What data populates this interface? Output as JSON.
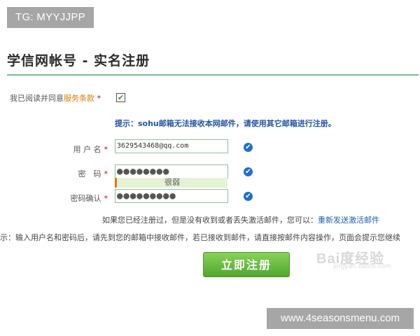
{
  "watermark_tag": "TG: MYYJJPP",
  "title": "学信网帐号 - 实名注册",
  "terms": {
    "prefix": "我已阅读并同意",
    "link_label": "服务条款",
    "required_mark": "*",
    "checked": true,
    "check_glyph": "✔"
  },
  "tip": "提示：sohu邮箱无法接收本网邮件，请使用其它邮箱进行注册。",
  "form": {
    "username": {
      "label": "用 户 名",
      "required_mark": "*",
      "value": "3629543468@qq.com"
    },
    "password": {
      "label": "密　码",
      "required_mark": "*",
      "masked_value": "●●●●●●●●",
      "strength_label": "很弱"
    },
    "confirm": {
      "label": "密码确认",
      "required_mark": "*",
      "masked_value": "●●●●●●●●●"
    }
  },
  "valid_icon_glyph": "✔",
  "resend": {
    "text": "如果您已经注册过，但是没有收到或者丢失激活邮件，您可以：",
    "link_label": "重新发送激活邮件"
  },
  "instruction": "示：输入用户名和密码后，请先到您的邮箱中接收邮件，若已接收到邮件，请直接按邮件内容操作，页面会提示您继续",
  "submit_label": "立即注册",
  "watermark_center": "Bai度经验",
  "watermark_center_sub": "jingyan.baidu.com",
  "site_watermark": "www.4seasonsmenu.com",
  "colors": {
    "accent_green": "#4fa82e",
    "title_rule": "#6fbf8a",
    "link_blue": "#1f5fb3",
    "link_orange": "#e07b00",
    "required_red": "#cc0000"
  }
}
